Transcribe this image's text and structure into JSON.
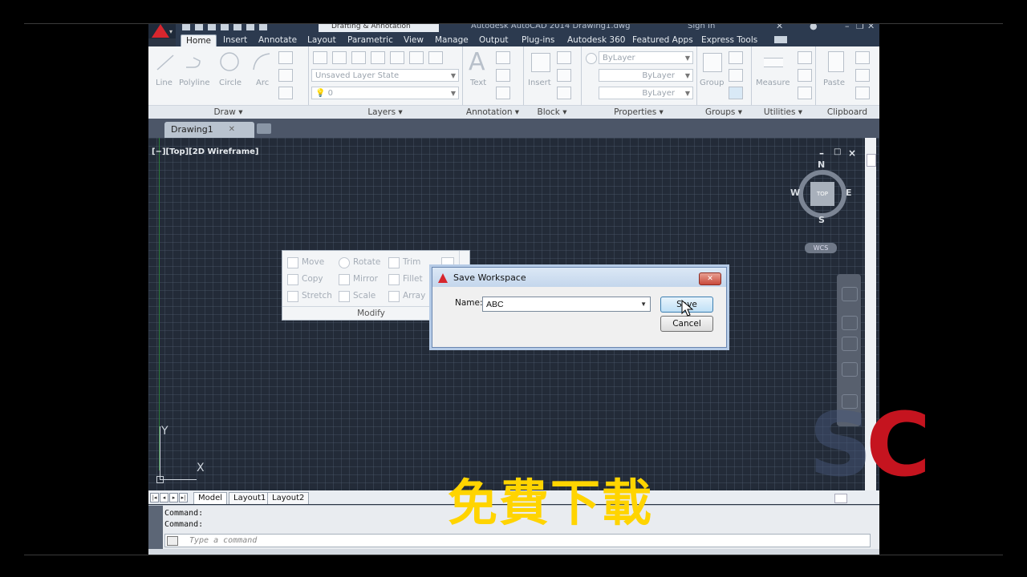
{
  "titlebar": {
    "workspace": "Drafting & Annotation",
    "app_title": "Autodesk AutoCAD 2014   Drawing1.dwg",
    "signin": "Sign In",
    "minimize": "–",
    "restore": "❐",
    "close": "✕"
  },
  "ribbon_tabs": [
    "Home",
    "Insert",
    "Annotate",
    "Layout",
    "Parametric",
    "View",
    "Manage",
    "Output",
    "Plug-ins",
    "Autodesk 360",
    "Featured Apps",
    "Express Tools"
  ],
  "ribbon": {
    "draw": {
      "title": "Draw ▾",
      "tools": [
        "Line",
        "Polyline",
        "Circle",
        "Arc"
      ]
    },
    "layers": {
      "title": "Layers ▾",
      "layer_state": "Unsaved Layer State",
      "layer_current": "0"
    },
    "annotation": {
      "title": "Annotation ▾",
      "text": "Text"
    },
    "block": {
      "title": "Block ▾",
      "insert": "Insert"
    },
    "properties": {
      "title": "Properties ▾",
      "color": "ByLayer",
      "linetype": "ByLayer",
      "lineweight": "ByLayer"
    },
    "groups": {
      "title": "Groups ▾",
      "group": "Group"
    },
    "utilities": {
      "title": "Utilities ▾",
      "measure": "Measure"
    },
    "clipboard": {
      "title": "Clipboard",
      "paste": "Paste"
    }
  },
  "file_tabs": {
    "drawing1": "Drawing1",
    "close": "✕"
  },
  "viewport": {
    "label": "[−][Top][2D Wireframe]",
    "ucs_y": "Y",
    "ucs_x": "X",
    "controls": {
      "min": "–",
      "max": "□",
      "close": "×"
    }
  },
  "viewcube": {
    "n": "N",
    "s": "S",
    "e": "E",
    "w": "W",
    "top": "TOP",
    "wcs": "WCS"
  },
  "modify_panel": {
    "title": "Modify",
    "tools": [
      "Move",
      "Rotate",
      "Trim",
      "Copy",
      "Mirror",
      "Fillet",
      "Stretch",
      "Scale",
      "Array"
    ]
  },
  "dialog": {
    "title": "Save Workspace",
    "name_label": "Name:",
    "name_value": "ABC",
    "save": "Save",
    "cancel": "Cancel",
    "close": "✕"
  },
  "layout_tabs": [
    "Model",
    "Layout1",
    "Layout2"
  ],
  "command": {
    "history": [
      "Command:",
      "Command:"
    ],
    "placeholder": "Type a command"
  },
  "overlay": {
    "text": "免費下載",
    "watermark_s": "S",
    "watermark_c": "C"
  },
  "colors": {
    "autocad_red": "#d7262e",
    "overlay_yellow": "#ffd400",
    "watermark_red": "#c5141f"
  }
}
